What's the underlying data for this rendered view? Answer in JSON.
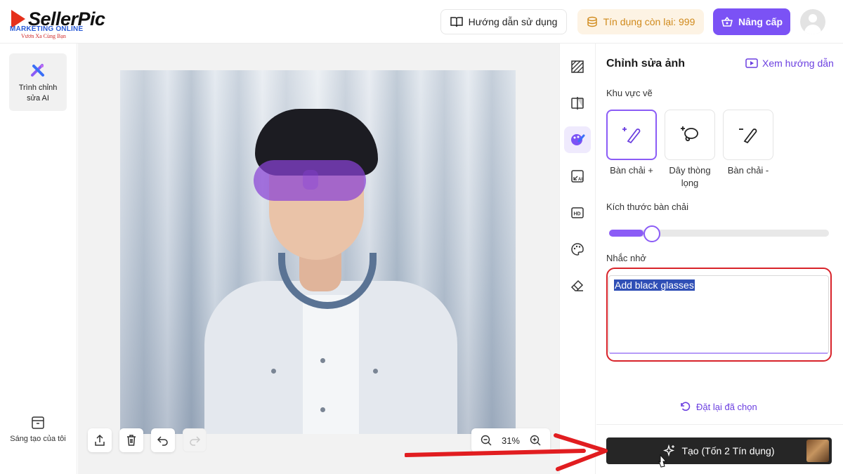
{
  "logo": {
    "brand": "SellerPic",
    "watermark_line1": "MARKETING ONLINE",
    "watermark_line2": "Vươn Xa Cùng Bạn"
  },
  "header": {
    "guide_label": "Hướng dẫn sử dụng",
    "credits_label": "Tín dụng còn lại: 999",
    "upgrade_label": "Nâng cấp"
  },
  "sidebar": {
    "tool_label": "Trình chỉnh sửa AI",
    "creations_label": "Sáng tạo của tôi"
  },
  "canvas": {
    "zoom": "31%"
  },
  "tool_strip": {
    "icons": [
      "background-pattern-icon",
      "compare-icon",
      "paint-palette-brush-icon",
      "ai-expand-icon",
      "hd-icon",
      "palette-icon",
      "eraser-icon"
    ],
    "active_index": 2
  },
  "panel": {
    "title": "Chỉnh sửa ảnh",
    "help_label": "Xem hướng dẫn",
    "draw_area_label": "Khu vực vẽ",
    "options": [
      {
        "label": "Bàn chải +",
        "icon": "brush-plus-icon",
        "selected": true
      },
      {
        "label": "Dây thòng lọng",
        "icon": "lasso-icon",
        "selected": false
      },
      {
        "label": "Bàn chải -",
        "icon": "brush-minus-icon",
        "selected": false
      }
    ],
    "brush_size_label": "Kích thước bàn chải",
    "brush_size_fraction": 0.13,
    "prompt_label": "Nhắc nhở",
    "prompt_value": "Add black glasses",
    "reset_label": "Đặt lại đã chọn",
    "create_label": "Tạo (Tốn 2 Tín dụng)"
  },
  "colors": {
    "accent": "#7b52f5",
    "mask": "#8942d6",
    "annotation": "#d8232a",
    "create_button": "#262626"
  }
}
